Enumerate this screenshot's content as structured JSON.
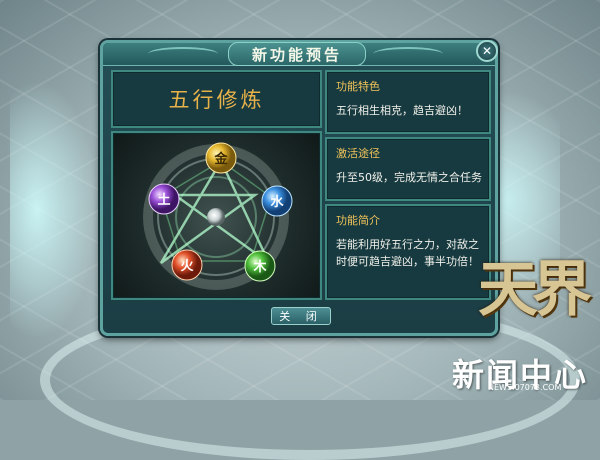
{
  "dialog": {
    "title": "新功能预告",
    "close_icon": "✕",
    "feature_name": "五行修炼",
    "sections": [
      {
        "title": "功能特色",
        "text": "五行相生相克，趋吉避凶！"
      },
      {
        "title": "激活途径",
        "text": "升至50级，完成无情之合任务"
      },
      {
        "title": "功能简介",
        "text": "若能利用好五行之力，对敌之时便可趋吉避凶，事半功倍！"
      }
    ],
    "close_button": "关 闭"
  },
  "elements": [
    {
      "label": "金",
      "color": "#e6b82f",
      "icon": "metal-orb"
    },
    {
      "label": "水",
      "color": "#3a8fe0",
      "icon": "water-orb"
    },
    {
      "label": "木",
      "color": "#4fbf3a",
      "icon": "wood-orb"
    },
    {
      "label": "火",
      "color": "#e2512a",
      "icon": "fire-orb"
    },
    {
      "label": "土",
      "color": "#9a4fd8",
      "icon": "earth-orb"
    }
  ],
  "logo": {
    "game": "天界",
    "brand": "新闻中心",
    "url": "NEWS.07073.COM"
  }
}
